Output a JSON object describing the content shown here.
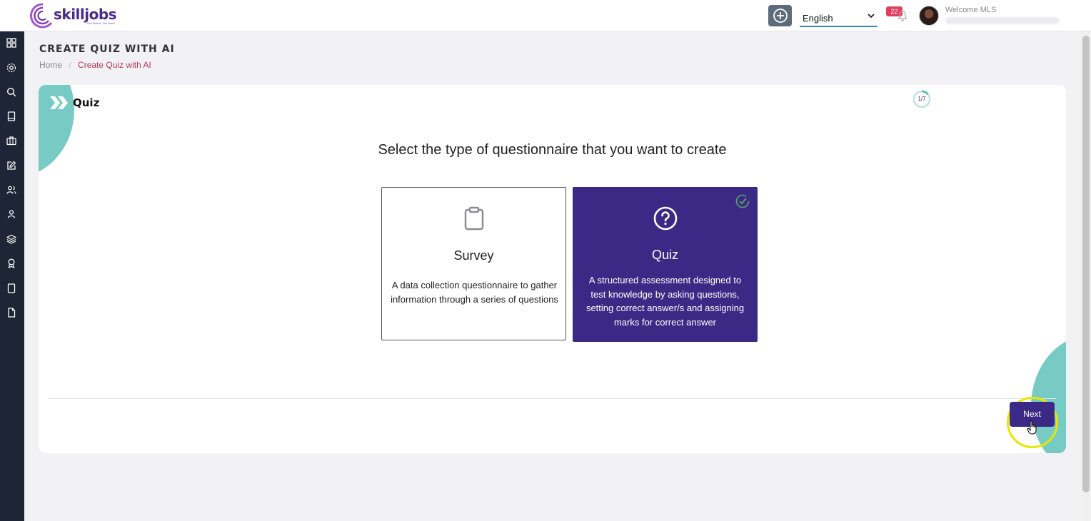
{
  "header": {
    "logo_text": "skilljobs",
    "logo_tagline": "Get Skilled, Get Hired",
    "language_selected": "English",
    "notification_count": "22",
    "welcome_text": "Welcome MLS"
  },
  "sidebar": {
    "items": [
      {
        "icon": "dashboard-grid-icon"
      },
      {
        "icon": "settings-gear-icon"
      },
      {
        "icon": "search-icon"
      },
      {
        "icon": "book-icon"
      },
      {
        "icon": "briefcase-icon"
      },
      {
        "icon": "edit-icon"
      },
      {
        "icon": "users-icon"
      },
      {
        "icon": "user-icon"
      },
      {
        "icon": "layers-icon"
      },
      {
        "icon": "award-icon"
      },
      {
        "icon": "tablet-icon"
      },
      {
        "icon": "file-icon"
      }
    ]
  },
  "page": {
    "title": "CREATE QUIZ WITH AI",
    "breadcrumb": {
      "home": "Home",
      "current": "Create Quiz with AI"
    }
  },
  "card": {
    "title": "Quiz",
    "step": "1/7",
    "step_fraction": 0.143,
    "question": "Select the type of questionnaire that you want to create",
    "options": [
      {
        "name": "Survey",
        "description": "A data collection questionnaire to gather information through a series of questions",
        "icon": "clipboard-icon",
        "selected": false
      },
      {
        "name": "Quiz",
        "description": "A structured assessment designed to test knowledge by asking questions, setting correct answer/s and assigning marks for correct answer",
        "icon": "question-circle-icon",
        "selected": true
      }
    ],
    "next_label": "Next"
  },
  "colors": {
    "primary": "#3b2a85",
    "teal_accent": "#78cbc4",
    "sidebar_bg": "#1d2536",
    "breadcrumb_active": "#b03a5b",
    "badge": "#e0405e"
  }
}
